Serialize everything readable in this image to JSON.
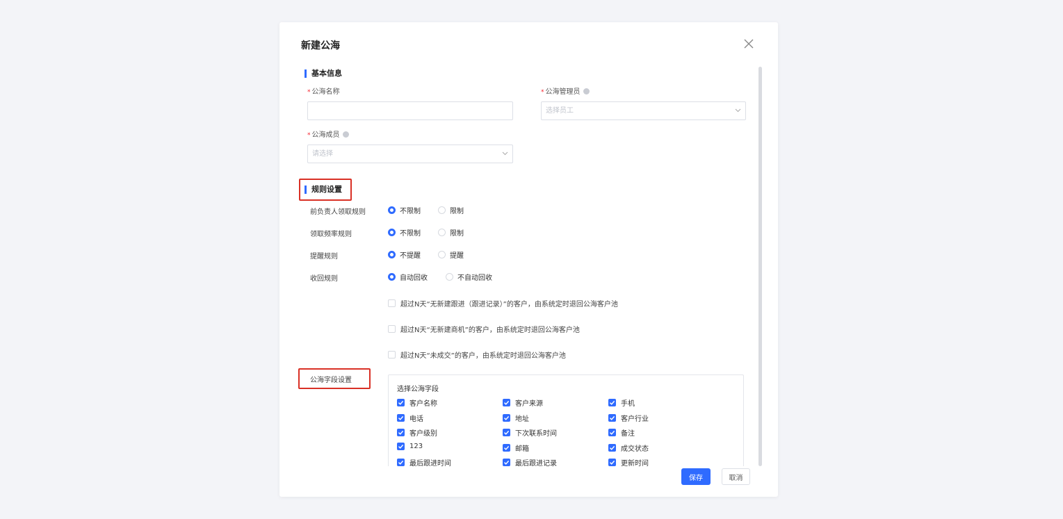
{
  "dialog": {
    "title": "新建公海",
    "close_icon": "close-icon"
  },
  "basic": {
    "section_title": "基本信息",
    "name_label": "公海名称",
    "name_value": "",
    "admin_label": "公海管理员",
    "admin_placeholder": "选择员工",
    "members_label": "公海成员",
    "members_placeholder": "请选择"
  },
  "rules": {
    "section_title": "规则设置",
    "items": [
      {
        "label": "前负责人领取规则",
        "options": [
          "不限制",
          "限制"
        ],
        "selected": 0
      },
      {
        "label": "领取频率规则",
        "options": [
          "不限制",
          "限制"
        ],
        "selected": 0
      },
      {
        "label": "提醒规则",
        "options": [
          "不提醒",
          "提醒"
        ],
        "selected": 0
      },
      {
        "label": "收回规则",
        "options": [
          "自动回收",
          "不自动回收"
        ],
        "selected": 0
      }
    ],
    "recycle_options": [
      "超过N天“无新建跟进（跟进记录）”的客户，由系统定时退回公海客户池",
      "超过N天“无新建商机”的客户，由系统定时退回公海客户池",
      "超过N天“未成交”的客户，由系统定时退回公海客户池"
    ]
  },
  "fields": {
    "section_label": "公海字段设置",
    "panel_title": "选择公海字段",
    "items": [
      "客户名称",
      "客户来源",
      "手机",
      "电话",
      "地址",
      "客户行业",
      "客户级别",
      "下次联系时间",
      "备注",
      "123",
      "邮箱",
      "成交状态",
      "最后跟进时间",
      "最后跟进记录",
      "更新时间"
    ]
  },
  "footer": {
    "save_label": "保存",
    "cancel_label": "取消"
  },
  "colors": {
    "accent": "#2f6bff",
    "highlight": "#d93025"
  }
}
